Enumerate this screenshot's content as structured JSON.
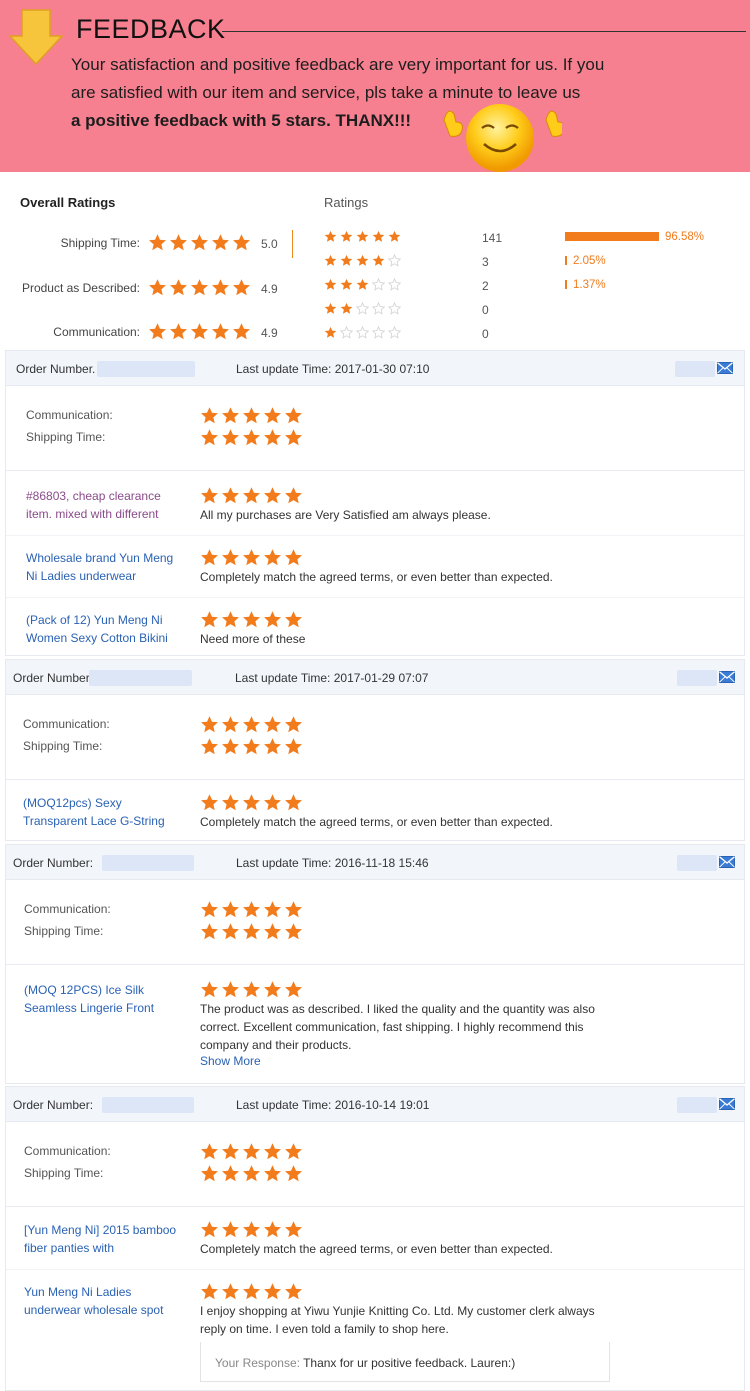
{
  "banner": {
    "title": "FEEDBACK",
    "line1": "Your satisfaction and positive feedback are very important for us. If you",
    "line2": "are satisfied with our item and service, pls take a minute to leave us",
    "line3": "a positive feedback with 5 stars. THANX!!!"
  },
  "colors": {
    "banner_bg": "#f6808f",
    "star": "#f27b1c",
    "link": "#2a62b4"
  },
  "overall": {
    "heading": "Overall Ratings",
    "items": [
      {
        "label": "Shipping Time:",
        "score": "5.0",
        "stars": 5
      },
      {
        "label": "Product as Described:",
        "score": "4.9",
        "stars": 5
      },
      {
        "label": "Communication:",
        "score": "4.9",
        "stars": 5
      }
    ]
  },
  "ratings": {
    "heading": "Ratings",
    "rows": [
      {
        "stars": 5,
        "count": "141",
        "pct": "96.58%",
        "fraction": 0.9658
      },
      {
        "stars": 4,
        "count": "3",
        "pct": "2.05%",
        "fraction": 0.0205
      },
      {
        "stars": 3,
        "count": "2",
        "pct": "1.37%",
        "fraction": 0.0137
      },
      {
        "stars": 2,
        "count": "0",
        "pct": "",
        "fraction": 0
      },
      {
        "stars": 1,
        "count": "0",
        "pct": "",
        "fraction": 0
      }
    ]
  },
  "orders": [
    {
      "order_label": "Order Number.",
      "time": "Last update Time: 2017-01-30 07:10",
      "communication_label": "Communication:",
      "shipping_label": "Shipping Time:",
      "items": [
        {
          "product": "#86803, cheap clearance item. mixed with different",
          "feedback": "All my purchases are Very Satisfied am always please."
        },
        {
          "product": "Wholesale brand Yun Meng Ni Ladies underwear",
          "feedback": "Completely match the agreed terms, or even better than expected."
        },
        {
          "product": "(Pack of 12) Yun Meng Ni Women Sexy Cotton Bikini",
          "feedback": "Need more of these"
        }
      ]
    },
    {
      "order_label": "Order Number",
      "time": "Last update Time: 2017-01-29 07:07",
      "communication_label": "Communication:",
      "shipping_label": "Shipping Time:",
      "items": [
        {
          "product": "(MOQ12pcs) Sexy Transparent Lace G-String",
          "feedback": "Completely match the agreed terms, or even better than expected."
        }
      ]
    },
    {
      "order_label": "Order Number:",
      "time": "Last update Time: 2016-11-18 15:46",
      "communication_label": "Communication:",
      "shipping_label": "Shipping Time:",
      "items": [
        {
          "product": "(MOQ 12PCS) Ice Silk Seamless Lingerie Front",
          "feedback": "The product was as described. I liked the quality and the quantity was also correct. Excellent communication, fast shipping. I highly recommend this company and their products.",
          "show_more": "Show More"
        }
      ]
    },
    {
      "order_label": "Order Number:",
      "time": "Last update Time: 2016-10-14 19:01",
      "communication_label": "Communication:",
      "shipping_label": "Shipping Time:",
      "items": [
        {
          "product": "[Yun Meng Ni] 2015 bamboo fiber panties with",
          "feedback": "Completely match the agreed terms, or even better than expected."
        },
        {
          "product": "Yun Meng Ni Ladies underwear wholesale spot",
          "feedback": "I enjoy shopping at Yiwu Yunjie Knitting Co. Ltd. My customer clerk always reply on time. I even told a family to shop here.",
          "response_label": "Your Response:",
          "response": "Thanx for ur positive feedback. Lauren:)"
        }
      ]
    }
  ]
}
